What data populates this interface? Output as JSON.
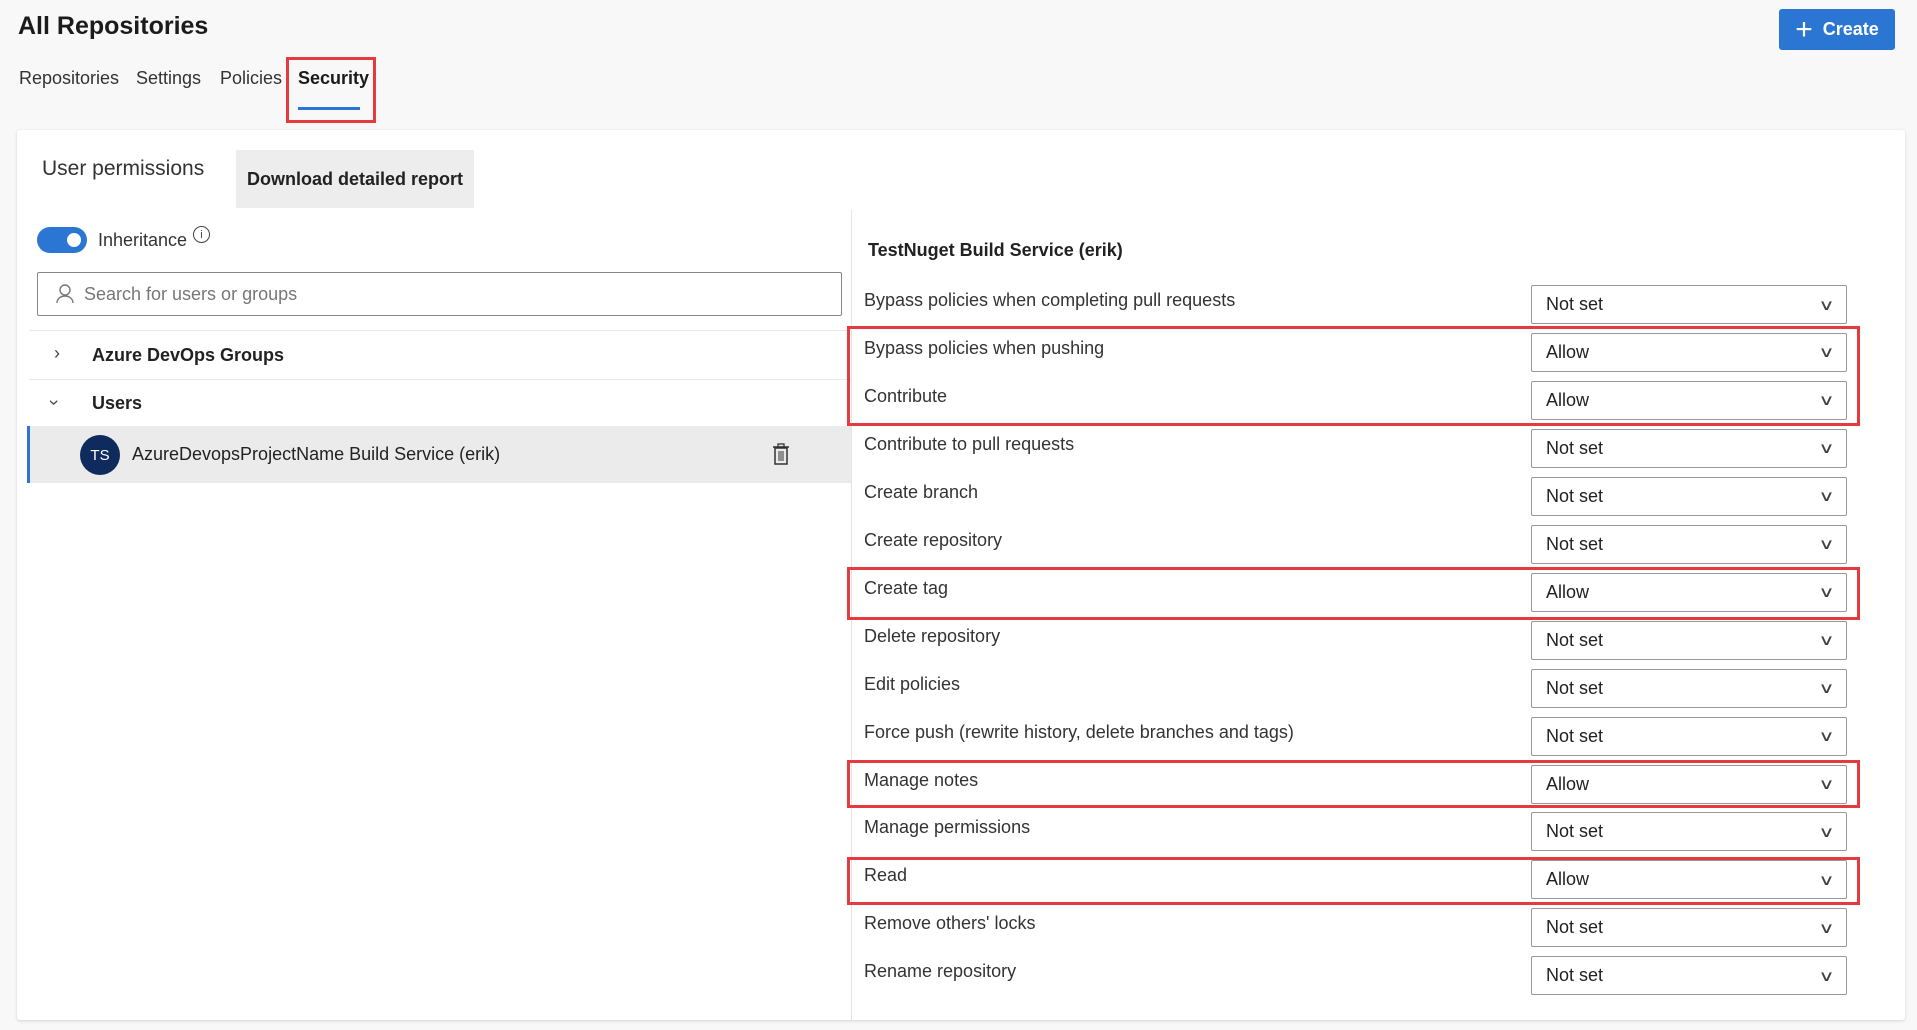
{
  "header": {
    "title": "All Repositories",
    "create_label": "Create"
  },
  "tabs": [
    {
      "label": "Repositories"
    },
    {
      "label": "Settings"
    },
    {
      "label": "Policies"
    },
    {
      "label": "Security",
      "active": true
    }
  ],
  "left": {
    "heading": "User permissions",
    "download_label": "Download detailed report",
    "inheritance_label": "Inheritance",
    "inheritance_on": true,
    "search_placeholder": "Search for users or groups",
    "groups": [
      {
        "label": "Azure DevOps Groups",
        "expanded": false
      },
      {
        "label": "Users",
        "expanded": true
      }
    ],
    "selected_user": {
      "initials": "TS",
      "name": "AzureDevopsProjectName Build Service (erik)"
    }
  },
  "right": {
    "identity": "TestNuget Build Service (erik)",
    "permissions": [
      {
        "label": "Bypass policies when completing pull requests",
        "value": "Not set"
      },
      {
        "label": "Bypass policies when pushing",
        "value": "Allow"
      },
      {
        "label": "Contribute",
        "value": "Allow"
      },
      {
        "label": "Contribute to pull requests",
        "value": "Not set"
      },
      {
        "label": "Create branch",
        "value": "Not set"
      },
      {
        "label": "Create repository",
        "value": "Not set"
      },
      {
        "label": "Create tag",
        "value": "Allow"
      },
      {
        "label": "Delete repository",
        "value": "Not set"
      },
      {
        "label": "Edit policies",
        "value": "Not set"
      },
      {
        "label": "Force push (rewrite history, delete branches and tags)",
        "value": "Not set"
      },
      {
        "label": "Manage notes",
        "value": "Allow"
      },
      {
        "label": "Manage permissions",
        "value": "Not set"
      },
      {
        "label": "Read",
        "value": "Allow"
      },
      {
        "label": "Remove others' locks",
        "value": "Not set"
      },
      {
        "label": "Rename repository",
        "value": "Not set"
      }
    ]
  },
  "colors": {
    "accent": "#2b76d2",
    "highlight": "#e33b3f",
    "avatar": "#0f2a5c"
  }
}
